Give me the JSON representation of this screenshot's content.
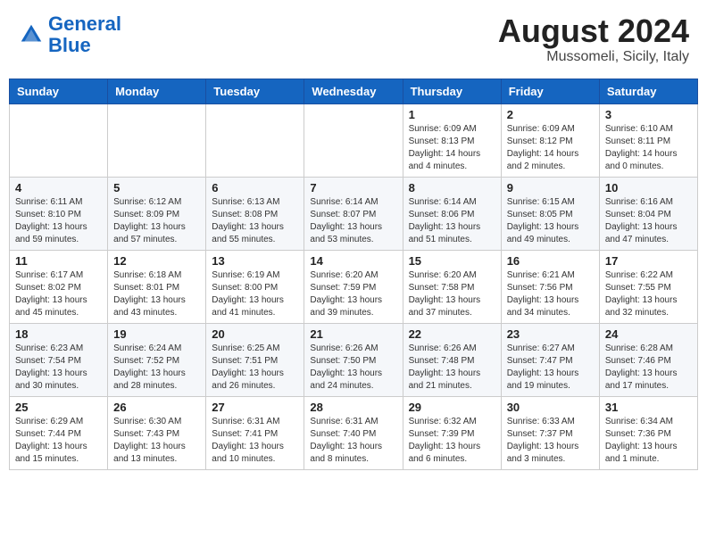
{
  "header": {
    "logo_line1": "General",
    "logo_line2": "Blue",
    "month_year": "August 2024",
    "location": "Mussomeli, Sicily, Italy"
  },
  "days_of_week": [
    "Sunday",
    "Monday",
    "Tuesday",
    "Wednesday",
    "Thursday",
    "Friday",
    "Saturday"
  ],
  "weeks": [
    [
      {
        "day": "",
        "info": ""
      },
      {
        "day": "",
        "info": ""
      },
      {
        "day": "",
        "info": ""
      },
      {
        "day": "",
        "info": ""
      },
      {
        "day": "1",
        "info": "Sunrise: 6:09 AM\nSunset: 8:13 PM\nDaylight: 14 hours\nand 4 minutes."
      },
      {
        "day": "2",
        "info": "Sunrise: 6:09 AM\nSunset: 8:12 PM\nDaylight: 14 hours\nand 2 minutes."
      },
      {
        "day": "3",
        "info": "Sunrise: 6:10 AM\nSunset: 8:11 PM\nDaylight: 14 hours\nand 0 minutes."
      }
    ],
    [
      {
        "day": "4",
        "info": "Sunrise: 6:11 AM\nSunset: 8:10 PM\nDaylight: 13 hours\nand 59 minutes."
      },
      {
        "day": "5",
        "info": "Sunrise: 6:12 AM\nSunset: 8:09 PM\nDaylight: 13 hours\nand 57 minutes."
      },
      {
        "day": "6",
        "info": "Sunrise: 6:13 AM\nSunset: 8:08 PM\nDaylight: 13 hours\nand 55 minutes."
      },
      {
        "day": "7",
        "info": "Sunrise: 6:14 AM\nSunset: 8:07 PM\nDaylight: 13 hours\nand 53 minutes."
      },
      {
        "day": "8",
        "info": "Sunrise: 6:14 AM\nSunset: 8:06 PM\nDaylight: 13 hours\nand 51 minutes."
      },
      {
        "day": "9",
        "info": "Sunrise: 6:15 AM\nSunset: 8:05 PM\nDaylight: 13 hours\nand 49 minutes."
      },
      {
        "day": "10",
        "info": "Sunrise: 6:16 AM\nSunset: 8:04 PM\nDaylight: 13 hours\nand 47 minutes."
      }
    ],
    [
      {
        "day": "11",
        "info": "Sunrise: 6:17 AM\nSunset: 8:02 PM\nDaylight: 13 hours\nand 45 minutes."
      },
      {
        "day": "12",
        "info": "Sunrise: 6:18 AM\nSunset: 8:01 PM\nDaylight: 13 hours\nand 43 minutes."
      },
      {
        "day": "13",
        "info": "Sunrise: 6:19 AM\nSunset: 8:00 PM\nDaylight: 13 hours\nand 41 minutes."
      },
      {
        "day": "14",
        "info": "Sunrise: 6:20 AM\nSunset: 7:59 PM\nDaylight: 13 hours\nand 39 minutes."
      },
      {
        "day": "15",
        "info": "Sunrise: 6:20 AM\nSunset: 7:58 PM\nDaylight: 13 hours\nand 37 minutes."
      },
      {
        "day": "16",
        "info": "Sunrise: 6:21 AM\nSunset: 7:56 PM\nDaylight: 13 hours\nand 34 minutes."
      },
      {
        "day": "17",
        "info": "Sunrise: 6:22 AM\nSunset: 7:55 PM\nDaylight: 13 hours\nand 32 minutes."
      }
    ],
    [
      {
        "day": "18",
        "info": "Sunrise: 6:23 AM\nSunset: 7:54 PM\nDaylight: 13 hours\nand 30 minutes."
      },
      {
        "day": "19",
        "info": "Sunrise: 6:24 AM\nSunset: 7:52 PM\nDaylight: 13 hours\nand 28 minutes."
      },
      {
        "day": "20",
        "info": "Sunrise: 6:25 AM\nSunset: 7:51 PM\nDaylight: 13 hours\nand 26 minutes."
      },
      {
        "day": "21",
        "info": "Sunrise: 6:26 AM\nSunset: 7:50 PM\nDaylight: 13 hours\nand 24 minutes."
      },
      {
        "day": "22",
        "info": "Sunrise: 6:26 AM\nSunset: 7:48 PM\nDaylight: 13 hours\nand 21 minutes."
      },
      {
        "day": "23",
        "info": "Sunrise: 6:27 AM\nSunset: 7:47 PM\nDaylight: 13 hours\nand 19 minutes."
      },
      {
        "day": "24",
        "info": "Sunrise: 6:28 AM\nSunset: 7:46 PM\nDaylight: 13 hours\nand 17 minutes."
      }
    ],
    [
      {
        "day": "25",
        "info": "Sunrise: 6:29 AM\nSunset: 7:44 PM\nDaylight: 13 hours\nand 15 minutes."
      },
      {
        "day": "26",
        "info": "Sunrise: 6:30 AM\nSunset: 7:43 PM\nDaylight: 13 hours\nand 13 minutes."
      },
      {
        "day": "27",
        "info": "Sunrise: 6:31 AM\nSunset: 7:41 PM\nDaylight: 13 hours\nand 10 minutes."
      },
      {
        "day": "28",
        "info": "Sunrise: 6:31 AM\nSunset: 7:40 PM\nDaylight: 13 hours\nand 8 minutes."
      },
      {
        "day": "29",
        "info": "Sunrise: 6:32 AM\nSunset: 7:39 PM\nDaylight: 13 hours\nand 6 minutes."
      },
      {
        "day": "30",
        "info": "Sunrise: 6:33 AM\nSunset: 7:37 PM\nDaylight: 13 hours\nand 3 minutes."
      },
      {
        "day": "31",
        "info": "Sunrise: 6:34 AM\nSunset: 7:36 PM\nDaylight: 13 hours\nand 1 minute."
      }
    ]
  ]
}
